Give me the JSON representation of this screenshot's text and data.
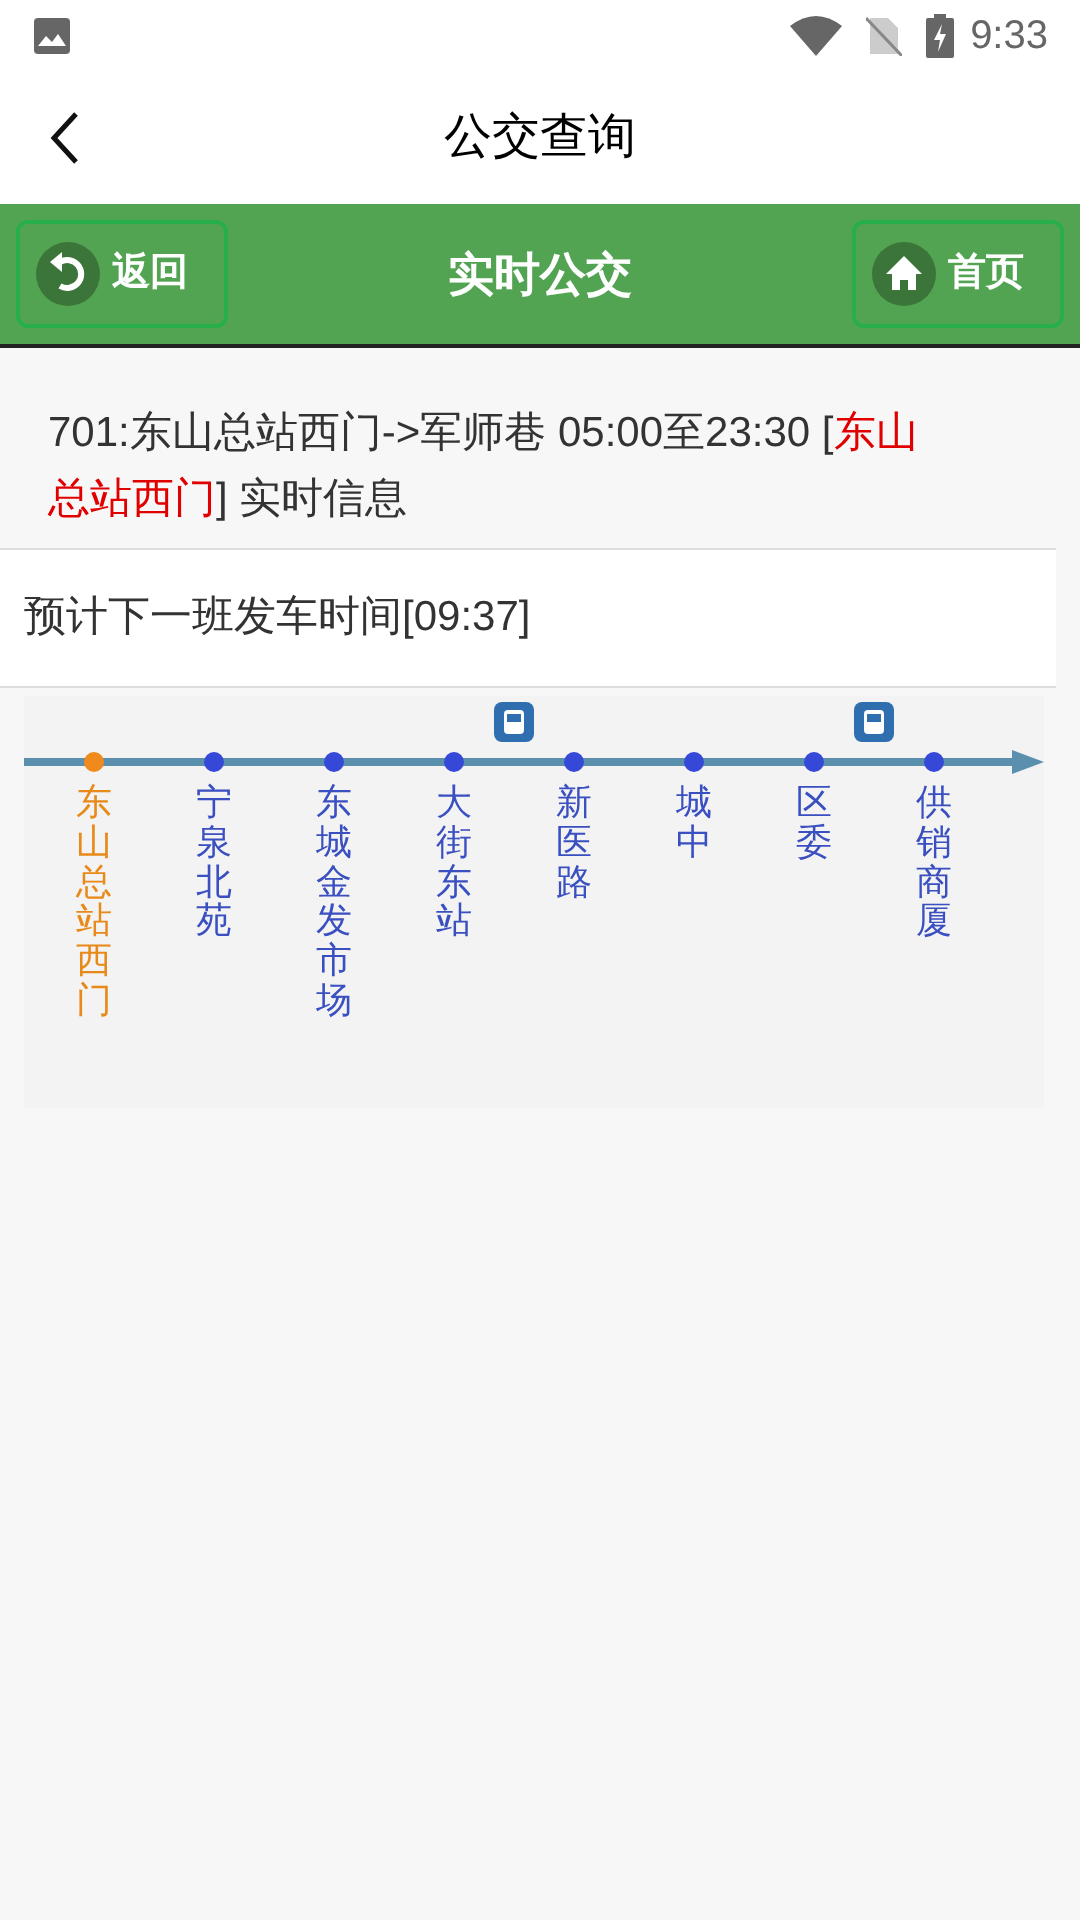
{
  "status_bar": {
    "time": "9:33"
  },
  "app_bar": {
    "title": "公交查询"
  },
  "header": {
    "back_label": "返回",
    "title": "实时公交",
    "home_label": "首页"
  },
  "route_info": {
    "text": "701:东山总站西门->军师巷 05:00至23:30 [",
    "station": "东山总站西门",
    "suffix": "] 实时信息"
  },
  "next_departure": "预计下一班发车时间[09:37]",
  "stops": [
    {
      "name": "东山总站西门",
      "selected": true,
      "bus_after": false
    },
    {
      "name": "宁泉北苑",
      "selected": false,
      "bus_after": false
    },
    {
      "name": "东城金发市场",
      "selected": false,
      "bus_after": false
    },
    {
      "name": "大街东站",
      "selected": false,
      "bus_after": true
    },
    {
      "name": "新医路",
      "selected": false,
      "bus_after": false
    },
    {
      "name": "城中",
      "selected": false,
      "bus_after": false
    },
    {
      "name": "区委",
      "selected": false,
      "bus_after": true
    },
    {
      "name": "供销商厦",
      "selected": false,
      "bus_after": false
    }
  ]
}
